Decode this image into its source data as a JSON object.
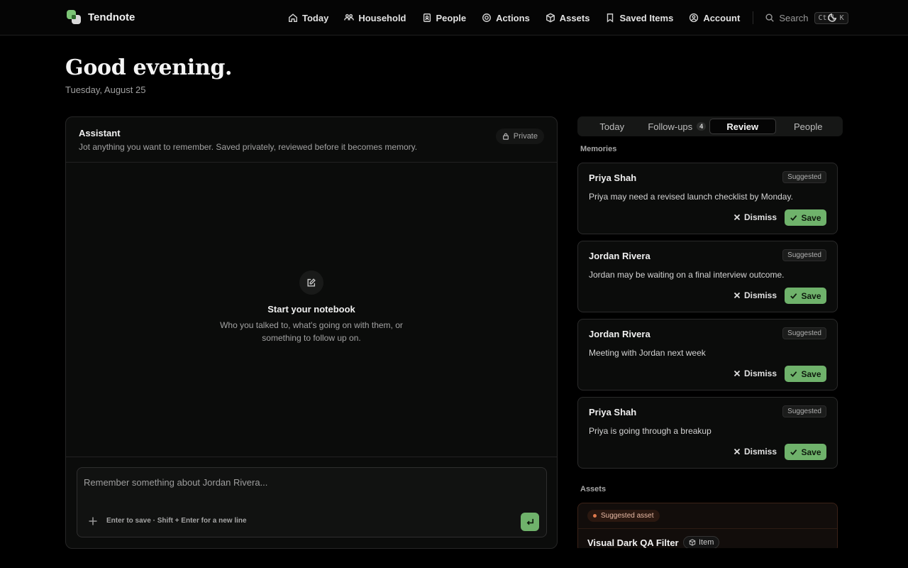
{
  "app": {
    "name": "Tendnote"
  },
  "nav": {
    "items": [
      {
        "label": "Today",
        "icon": "home-icon"
      },
      {
        "label": "Household",
        "icon": "users-icon"
      },
      {
        "label": "People",
        "icon": "contacts-icon"
      },
      {
        "label": "Actions",
        "icon": "target-icon"
      },
      {
        "label": "Assets",
        "icon": "box-icon"
      },
      {
        "label": "Saved Items",
        "icon": "bookmark-icon"
      },
      {
        "label": "Account",
        "icon": "user-circle-icon"
      }
    ],
    "search_label": "Search",
    "search_shortcut": "Ctrl K",
    "theme_icon": "moon-icon"
  },
  "greeting": {
    "title": "Good evening.",
    "date": "Tuesday, August 25"
  },
  "assistant": {
    "title": "Assistant",
    "subtitle": "Jot anything you want to remember. Saved privately, reviewed before it becomes memory.",
    "private_label": "Private",
    "empty_title": "Start your notebook",
    "empty_text": "Who you talked to, what's going on with them, or something to follow up on.",
    "composer_placeholder": "Remember something about Jordan Rivera...",
    "composer_value": "",
    "composer_hint": "Enter to save · Shift + Enter for a new line"
  },
  "tabs": [
    {
      "label": "Today",
      "count": "",
      "active": false
    },
    {
      "label": "Follow-ups",
      "count": "4",
      "active": false
    },
    {
      "label": "Review",
      "count": "",
      "active": true
    },
    {
      "label": "People",
      "count": "",
      "active": false
    }
  ],
  "memories": {
    "label": "Memories",
    "dismiss_label": "Dismiss",
    "save_label": "Save",
    "items": [
      {
        "name": "Priya Shah",
        "badge": "Suggested",
        "text": "Priya may need a revised launch checklist by Monday."
      },
      {
        "name": "Jordan Rivera",
        "badge": "Suggested",
        "text": "Jordan may be waiting on a final interview outcome."
      },
      {
        "name": "Jordan Rivera",
        "badge": "Suggested",
        "text": "Meeting with Jordan next week"
      },
      {
        "name": "Priya Shah",
        "badge": "Suggested",
        "text": "Priya is going through a breakup"
      }
    ]
  },
  "assets": {
    "label": "Assets",
    "badge": "Suggested asset",
    "title": "Visual Dark QA Filter",
    "type": "Item"
  },
  "colors": {
    "accent_green": "#6fb26b",
    "asset_orange": "#e07a4d",
    "background": "#000000"
  }
}
